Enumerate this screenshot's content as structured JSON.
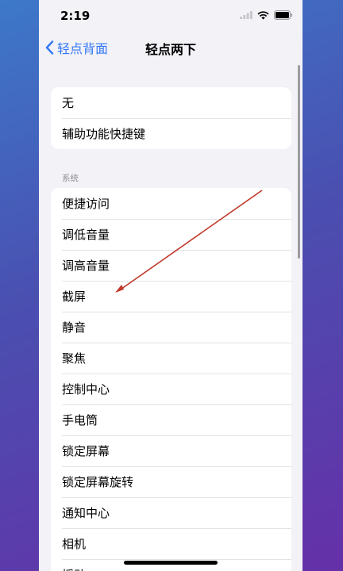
{
  "status_bar": {
    "time": "2:19"
  },
  "nav": {
    "back_label": "轻点背面",
    "title": "轻点两下"
  },
  "group_top": {
    "items": [
      "无",
      "辅助功能快捷键"
    ]
  },
  "system": {
    "section_label": "系统",
    "items": [
      "便捷访问",
      "调低音量",
      "调高音量",
      "截屏",
      "静音",
      "聚焦",
      "控制中心",
      "手电筒",
      "锁定屏幕",
      "锁定屏幕旋转",
      "通知中心",
      "相机",
      "摇动"
    ]
  },
  "colors": {
    "accent": "#3478f6",
    "arrow": "#c0392b"
  },
  "icons": [
    "signal-icon",
    "wifi-icon",
    "battery-icon",
    "chevron-left-icon"
  ]
}
